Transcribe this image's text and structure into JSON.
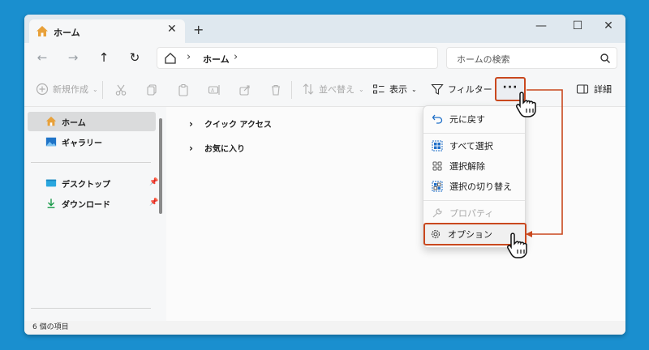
{
  "tab": {
    "title": "ホーム",
    "close": "✕",
    "new": "+"
  },
  "window_controls": {
    "minimize": "—",
    "maximize": "☐",
    "close": "✕"
  },
  "nav": {
    "back": "←",
    "forward": "→",
    "up": "↑",
    "refresh": "↻"
  },
  "address": {
    "crumb_sep": "›",
    "crumb": "ホーム",
    "crumb_end": "›"
  },
  "search": {
    "placeholder": "ホームの検索"
  },
  "toolbar": {
    "new_label": "新規作成",
    "sort_label": "並べ替え",
    "view_label": "表示",
    "filter_label": "フィルター",
    "more_label": "···",
    "details_label": "詳細"
  },
  "sidebar": {
    "items": [
      {
        "label": "ホーム"
      },
      {
        "label": "ギャラリー"
      },
      {
        "label": "デスクトップ"
      },
      {
        "label": "ダウンロード"
      }
    ],
    "pin": "📌"
  },
  "content": {
    "groups": [
      {
        "label": "クイック アクセス",
        "chevron": "›"
      },
      {
        "label": "お気に入り",
        "chevron": "›"
      }
    ]
  },
  "status": {
    "item_count": "6 個の項目"
  },
  "menu": {
    "items": [
      {
        "label": "元に戻す"
      },
      {
        "label": "すべて選択"
      },
      {
        "label": "選択解除"
      },
      {
        "label": "選択の切り替え"
      },
      {
        "label": "プロパティ"
      },
      {
        "label": "オプション"
      }
    ]
  },
  "colors": {
    "highlight": "#c9481e",
    "background": "#1a8fcf",
    "accent": "#0067c0"
  },
  "icons": [
    "home-icon",
    "search-icon",
    "cut-icon",
    "copy-icon",
    "paste-icon",
    "rename-icon",
    "share-icon",
    "delete-icon",
    "sort-icon",
    "view-icon",
    "filter-icon",
    "details-icon",
    "gallery-icon",
    "desktop-icon",
    "download-icon",
    "undo-icon",
    "select-all-icon",
    "select-none-icon",
    "invert-selection-icon",
    "properties-icon",
    "options-icon",
    "hand-cursor-icon"
  ]
}
